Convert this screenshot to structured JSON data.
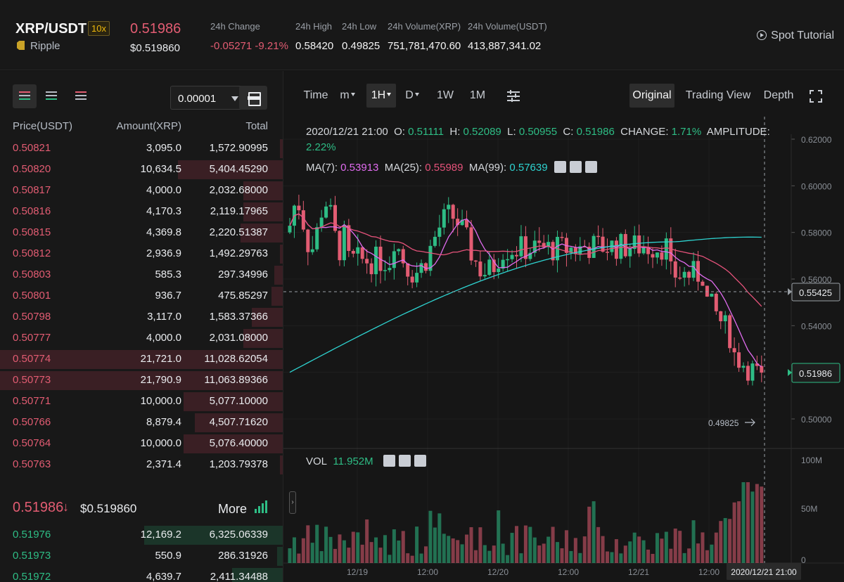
{
  "header": {
    "pair": "XRP/USDT",
    "leverage": "10x",
    "coin_name": "Ripple",
    "last_price": "0.51986",
    "last_price_usd": "$0.519860",
    "stats": [
      {
        "label": "24h Change",
        "value": "-0.05271 -9.21%"
      },
      {
        "label": "24h High",
        "value": "0.58420"
      },
      {
        "label": "24h Low",
        "value": "0.49825"
      },
      {
        "label": "24h Volume(XRP)",
        "value": "751,781,470.60"
      },
      {
        "label": "24h Volume(USDT)",
        "value": "413,887,341.02"
      }
    ],
    "tutorial": "Spot Tutorial"
  },
  "orderbook": {
    "tick_size": "0.00001",
    "col_price": "Price(USDT)",
    "col_amount": "Amount(XRP)",
    "col_total": "Total",
    "asks": [
      {
        "price": "0.50821",
        "amount": "3,095.0",
        "total": "1,572.90995",
        "depth": 0.01
      },
      {
        "price": "0.50820",
        "amount": "10,634.5",
        "total": "5,404.45290",
        "depth": 0.37
      },
      {
        "price": "0.50817",
        "amount": "4,000.0",
        "total": "2,032.68000",
        "depth": 0.14
      },
      {
        "price": "0.50816",
        "amount": "4,170.3",
        "total": "2,119.17965",
        "depth": 0.14
      },
      {
        "price": "0.50815",
        "amount": "4,369.8",
        "total": "2,220.51387",
        "depth": 0.15
      },
      {
        "price": "0.50812",
        "amount": "2,936.9",
        "total": "1,492.29763",
        "depth": 0.01
      },
      {
        "price": "0.50803",
        "amount": "585.3",
        "total": "297.34996",
        "depth": 0.03
      },
      {
        "price": "0.50801",
        "amount": "936.7",
        "total": "475.85297",
        "depth": 0.04
      },
      {
        "price": "0.50798",
        "amount": "3,117.0",
        "total": "1,583.37366",
        "depth": 0.11
      },
      {
        "price": "0.50777",
        "amount": "4,000.0",
        "total": "2,031.08000",
        "depth": 0.14
      },
      {
        "price": "0.50774",
        "amount": "21,721.0",
        "total": "11,028.62054",
        "depth": 1.0
      },
      {
        "price": "0.50773",
        "amount": "21,790.9",
        "total": "11,063.89366",
        "depth": 1.0
      },
      {
        "price": "0.50771",
        "amount": "10,000.0",
        "total": "5,077.10000",
        "depth": 0.35
      },
      {
        "price": "0.50766",
        "amount": "8,879.4",
        "total": "4,507.71620",
        "depth": 0.31
      },
      {
        "price": "0.50764",
        "amount": "10,000.0",
        "total": "5,076.40000",
        "depth": 0.35
      },
      {
        "price": "0.50763",
        "amount": "2,371.4",
        "total": "1,203.79378",
        "depth": 0.01
      }
    ],
    "mid_price": "0.51986",
    "mid_arrow": "↓",
    "mid_price_usd": "$0.519860",
    "more": "More",
    "bids": [
      {
        "price": "0.51976",
        "amount": "12,169.2",
        "total": "6,325.06339",
        "depth": 0.49
      },
      {
        "price": "0.51973",
        "amount": "550.9",
        "total": "286.31926",
        "depth": 0.02
      },
      {
        "price": "0.51972",
        "amount": "4,639.7",
        "total": "2,411.34488",
        "depth": 0.18
      }
    ]
  },
  "chart_toolbar": {
    "intervals": [
      "Time",
      "m",
      "1H",
      "D",
      "1W",
      "1M"
    ],
    "active_interval": "1H",
    "views": [
      "Original",
      "Trading View",
      "Depth"
    ],
    "active_view": "Original"
  },
  "ohlc": {
    "date": "2020/12/21 21:00",
    "o_label": "O:",
    "o": "0.51111",
    "h_label": "H:",
    "h": "0.52089",
    "l_label": "L:",
    "l": "0.50955",
    "c_label": "C:",
    "c": "0.51986",
    "change_label": "CHANGE:",
    "change": "1.71%",
    "amp_label": "AMPLITUDE:",
    "amp": "2.22%"
  },
  "ma": {
    "ma7_label": "MA(7):",
    "ma7": "0.53913",
    "ma25_label": "MA(25):",
    "ma25": "0.55989",
    "ma99_label": "MA(99):",
    "ma99": "0.57639"
  },
  "vol": {
    "label": "VOL",
    "value": "11.952M"
  },
  "chart_data": {
    "type": "candlestick",
    "y_ticks": [
      "0.62000",
      "0.60000",
      "0.58000",
      "0.56000",
      "0.54000",
      "0.50000"
    ],
    "vol_ticks": [
      "100M",
      "50M",
      "0"
    ],
    "x_ticks": [
      "12/19",
      "12:00",
      "12/20",
      "12:00",
      "12/21",
      "12:00"
    ],
    "crosshair_price": "0.55425",
    "current_price": "0.51986",
    "low_marker": "0.49825",
    "crosshair_time": "2020/12/21 21:00",
    "colors": {
      "up": "#2EBD85",
      "down": "#E25C72",
      "ma7": "#E16CF0",
      "ma25": "#E5527A",
      "ma99": "#2ED3D0"
    }
  }
}
